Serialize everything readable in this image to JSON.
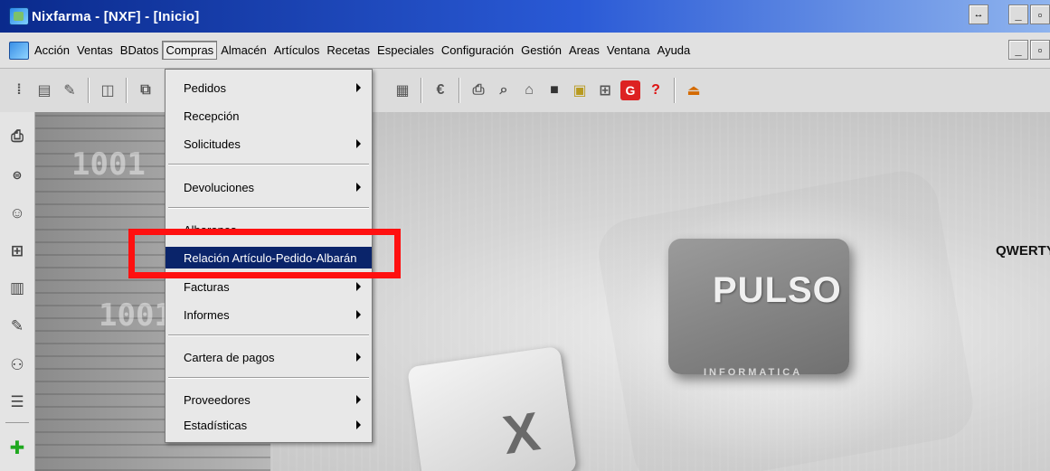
{
  "window": {
    "title": "Nixfarma - [NXF] - [Inicio]"
  },
  "menubar": {
    "items": [
      "Acción",
      "Ventas",
      "BDatos",
      "Compras",
      "Almacén",
      "Artículos",
      "Recetas",
      "Especiales",
      "Configuración",
      "Gestión",
      "Areas",
      "Ventana",
      "Ayuda"
    ],
    "active": "Compras"
  },
  "dropdown": {
    "items": [
      {
        "label": "Pedidos",
        "submenu": true
      },
      {
        "label": "Recepción",
        "submenu": false
      },
      {
        "label": "Solicitudes",
        "submenu": true
      },
      {
        "label": "Devoluciones",
        "submenu": true
      },
      {
        "label": "Albaranes",
        "submenu": false
      },
      {
        "label": "Relación Artículo-Pedido-Albarán",
        "submenu": false,
        "selected": true
      },
      {
        "label": "Facturas",
        "submenu": true
      },
      {
        "label": "Informes",
        "submenu": true
      },
      {
        "label": "Cartera de pagos",
        "submenu": true
      },
      {
        "label": "Proveedores",
        "submenu": true
      },
      {
        "label": "Estadísticas",
        "submenu": true
      }
    ]
  },
  "background": {
    "brand": "PULSO",
    "brand_sub": "INFORMATICA",
    "key_label": "X",
    "binary_1": "1001",
    "binary_2": "1001",
    "corner_label": "QWERTY"
  },
  "colors": {
    "title_gradient_start": "#0a2a8c",
    "selected_item": "#0a246a",
    "highlight": "#ff1010"
  }
}
